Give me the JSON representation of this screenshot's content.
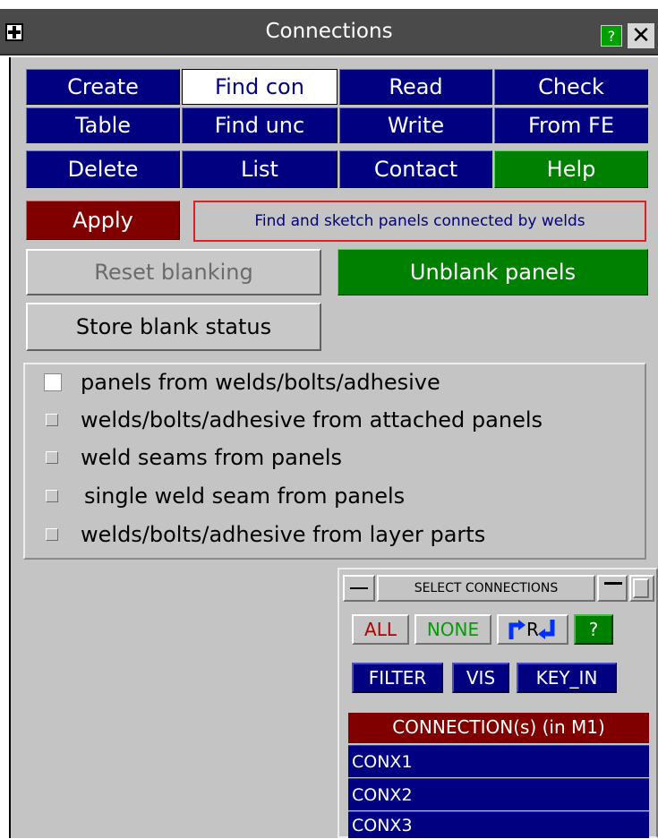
{
  "window": {
    "title": "Connections",
    "help_label": "?",
    "close_label": "✕"
  },
  "buttons": {
    "create": "Create",
    "find_con": "Find con",
    "read": "Read",
    "check": "Check",
    "table": "Table",
    "find_unc": "Find unc",
    "write": "Write",
    "from_fe": "From FE",
    "delete": "Delete",
    "list": "List",
    "contact": "Contact",
    "help": "Help",
    "apply": "Apply",
    "reset_blanking": "Reset blanking",
    "unblank_panels": "Unblank panels",
    "store_blank_status": "Store blank status"
  },
  "hint": "Find and sketch panels connected by welds",
  "options": [
    {
      "label": "panels from welds/bolts/adhesive",
      "checked": true
    },
    {
      "label": "welds/bolts/adhesive from attached panels",
      "checked": false
    },
    {
      "label": "weld seams from panels",
      "checked": false
    },
    {
      "label": "single weld seam from panels",
      "checked": false
    },
    {
      "label": "welds/bolts/adhesive from layer parts",
      "checked": false
    }
  ],
  "select_widget": {
    "title": "SELECT CONNECTIONS",
    "all": "ALL",
    "none": "NONE",
    "reverse_r": "R",
    "help": "?",
    "filter": "FILTER",
    "vis": "VIS",
    "key_in": "KEY_IN",
    "list_header": "CONNECTION(s) (in M1)",
    "items": [
      "CONX1",
      "CONX2",
      "CONX3"
    ]
  },
  "colors": {
    "navy": "#000080",
    "green": "#008000",
    "darkred": "#800000",
    "panel_grey": "#c4c4c4",
    "hint_border": "#e02020"
  }
}
